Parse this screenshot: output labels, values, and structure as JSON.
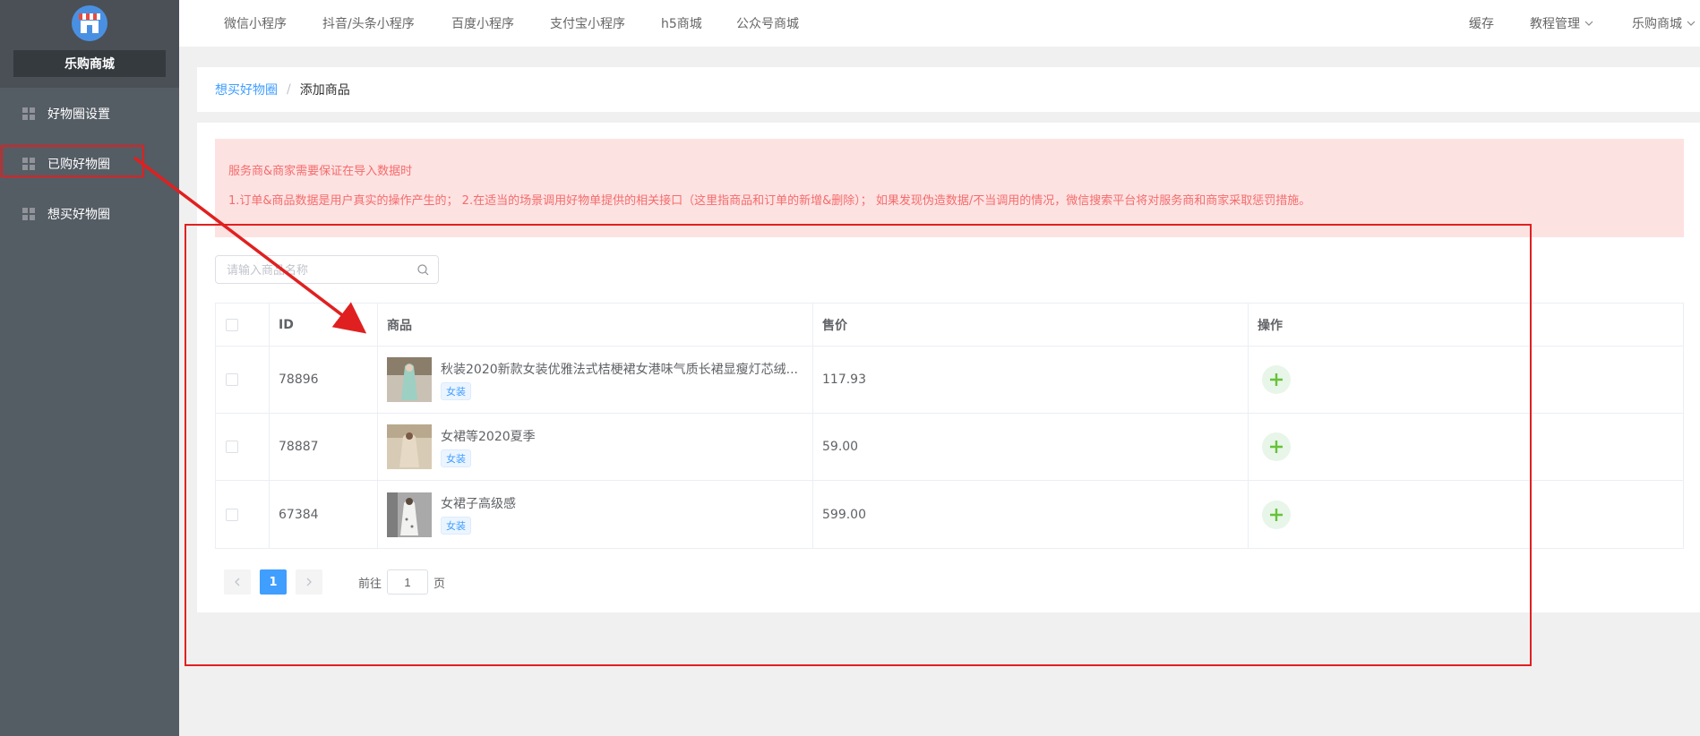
{
  "sidebar": {
    "shop_name": "乐购商城",
    "items": [
      {
        "label": "好物圈设置",
        "icon": "grid-icon"
      },
      {
        "label": "已购好物圈",
        "icon": "grid-icon"
      },
      {
        "label": "想买好物圈",
        "icon": "grid-icon"
      }
    ]
  },
  "topnav": {
    "items": [
      "微信小程序",
      "抖音/头条小程序",
      "百度小程序",
      "支付宝小程序",
      "h5商城",
      "公众号商城"
    ],
    "right": [
      "缓存",
      "教程管理",
      "乐购商城"
    ]
  },
  "breadcrumb": {
    "parent": "想买好物圈",
    "separator": "/",
    "current": "添加商品"
  },
  "alert": {
    "line1": "服务商&商家需要保证在导入数据时",
    "line2": "1.订单&商品数据是用户真实的操作产生的； 2.在适当的场景调用好物单提供的相关接口（这里指商品和订单的新增&删除）； 如果发现伪造数据/不当调用的情况，微信搜索平台将对服务商和商家采取惩罚措施。"
  },
  "search": {
    "placeholder": "请输入商品名称"
  },
  "table": {
    "headers": {
      "id": "ID",
      "goods": "商品",
      "price": "售价",
      "op": "操作"
    },
    "rows": [
      {
        "id": "78896",
        "title": "秋装2020新款女装优雅法式桔梗裙女港味气质长裙显瘦灯芯绒...",
        "tag": "女装",
        "price": "117.93"
      },
      {
        "id": "78887",
        "title": "女裙等2020夏季",
        "tag": "女装",
        "price": "59.00"
      },
      {
        "id": "67384",
        "title": "女裙子高级感",
        "tag": "女装",
        "price": "599.00"
      }
    ]
  },
  "pagination": {
    "current": "1",
    "goto_label": "前往",
    "goto_value": "1",
    "page_suffix": "页"
  },
  "colors": {
    "sidebar_bg": "#545c64",
    "accent": "#409eff",
    "alert_bg": "#fde2e2",
    "alert_text": "#f56c6c",
    "annotation_red": "#e02020"
  }
}
